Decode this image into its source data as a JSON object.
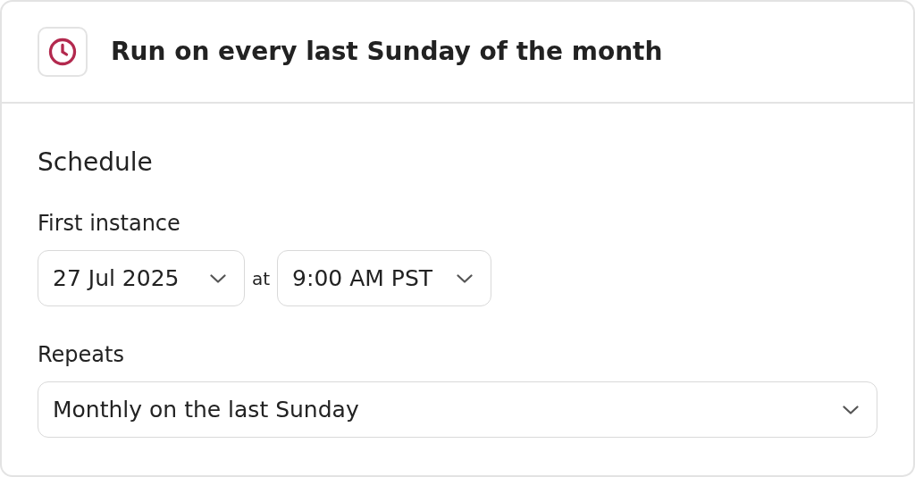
{
  "header": {
    "title": "Run on every last Sunday of the month"
  },
  "section": {
    "title": "Schedule"
  },
  "first_instance": {
    "label": "First instance",
    "date": "27 Jul 2025",
    "separator": "at",
    "time": "9:00 AM PST"
  },
  "repeats": {
    "label": "Repeats",
    "value": "Monthly on the last Sunday"
  }
}
